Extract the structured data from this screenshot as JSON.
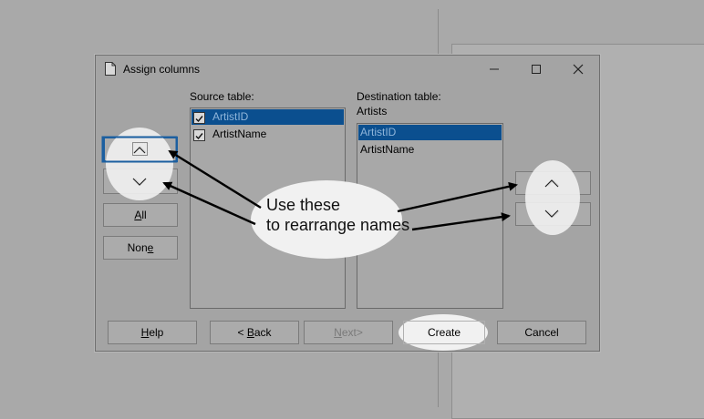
{
  "dialog": {
    "title": "Assign columns",
    "source_label": "Source table:",
    "destination_label": "Destination table:",
    "destination_name": "Artists",
    "source_columns": [
      {
        "label": "ArtistID",
        "checked": true,
        "selected": true
      },
      {
        "label": "ArtistName",
        "checked": true,
        "selected": false
      }
    ],
    "destination_columns": [
      {
        "label": "ArtistID",
        "selected": true
      },
      {
        "label": "ArtistName",
        "selected": false
      }
    ],
    "left_buttons": {
      "all_prefix": "",
      "all_mnemonic": "A",
      "all_rest": "ll",
      "none_prefix": "Non",
      "none_mnemonic": "e",
      "none_rest": ""
    },
    "footer": {
      "help_mnemonic": "H",
      "help_rest": "elp",
      "back_prefix": "< ",
      "back_mnemonic": "B",
      "back_rest": "ack",
      "next_mnemonic": "N",
      "next_rest": "ext>",
      "create_label": "Create",
      "cancel_label": "Cancel"
    }
  },
  "annotation": {
    "line1": "Use these",
    "line2": "to rearrange names"
  },
  "colors": {
    "selection": "#0b4f8f",
    "highlight": "#f1f1f1"
  }
}
